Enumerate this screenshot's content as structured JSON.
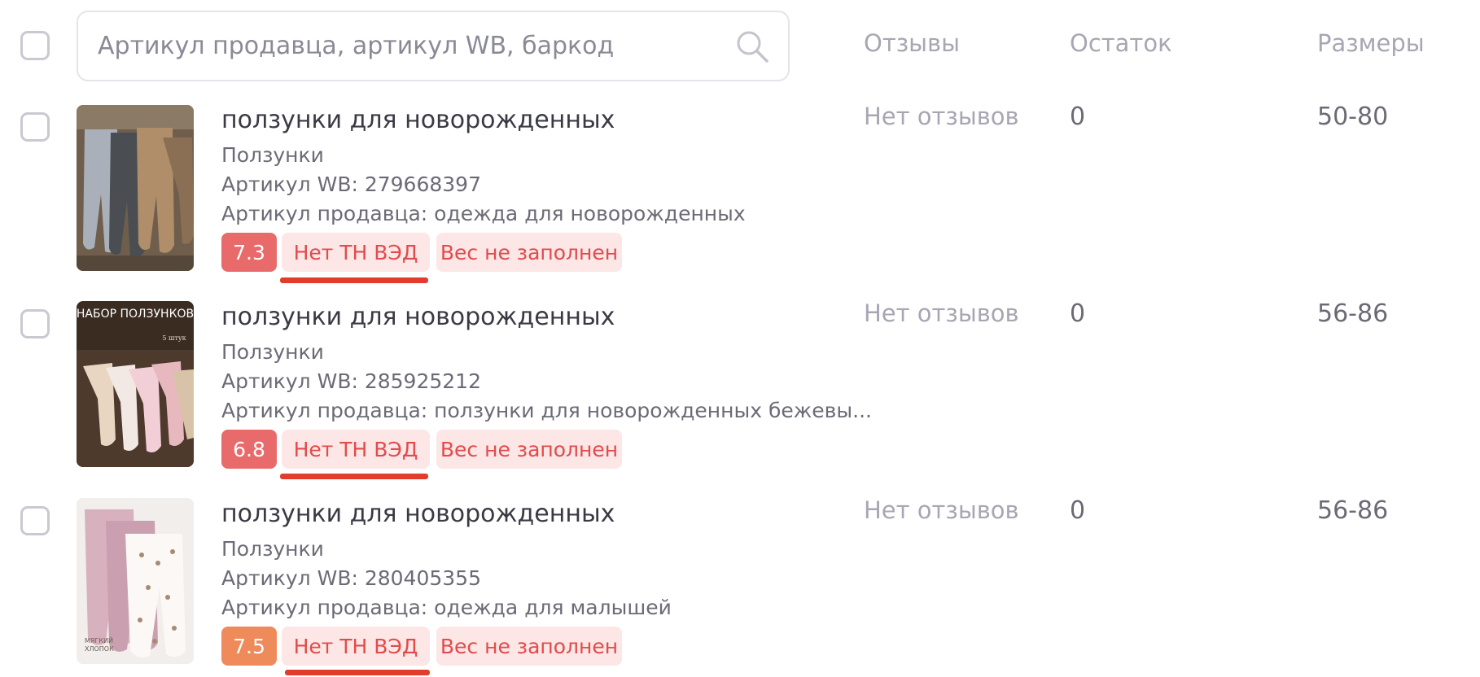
{
  "search": {
    "placeholder": "Артикул продавца, артикул WB, баркод"
  },
  "columns": {
    "reviews": "Отзывы",
    "stock": "Остаток",
    "sizes": "Размеры"
  },
  "colors": {
    "rating_red": "#e86a6a",
    "rating_orange": "#ef8a5a",
    "tag_bg": "#fce6e6",
    "tag_text": "#e24b4b",
    "underline": "#e23c2d"
  },
  "products": [
    {
      "title": "ползунки для новорожденных",
      "category": "Ползунки",
      "wb_article": "Артикул WB: 279668397",
      "seller_article": "Артикул продавца: одежда для новорожденных",
      "rating": "7.3",
      "tag_tnved": "Нет ТН ВЭД",
      "tag_weight": "Вес не заполнен",
      "reviews": "Нет отзывов",
      "stock": "0",
      "sizes": "50-80"
    },
    {
      "title": "ползунки для новорожденных",
      "category": "Ползунки",
      "wb_article": "Артикул WB: 285925212",
      "seller_article": "Артикул продавца: ползунки для новорожденных бежевы...",
      "rating": "6.8",
      "tag_tnved": "Нет ТН ВЭД",
      "tag_weight": "Вес не заполнен",
      "reviews": "Нет отзывов",
      "stock": "0",
      "sizes": "56-86",
      "image_text": {
        "banner": "НАБОР ПОЛЗУНКОВ",
        "count": "5 штук"
      }
    },
    {
      "title": "ползунки для новорожденных",
      "category": "Ползунки",
      "wb_article": "Артикул WB: 280405355",
      "seller_article": "Артикул продавца: одежда для малышей",
      "rating": "7.5",
      "tag_tnved": "Нет ТН ВЭД",
      "tag_weight": "Вес не заполнен",
      "reviews": "Нет отзывов",
      "stock": "0",
      "sizes": "56-86",
      "image_text": {
        "caption_1": "МЯГКИЙ",
        "caption_2": "ХЛОПОК"
      }
    }
  ]
}
